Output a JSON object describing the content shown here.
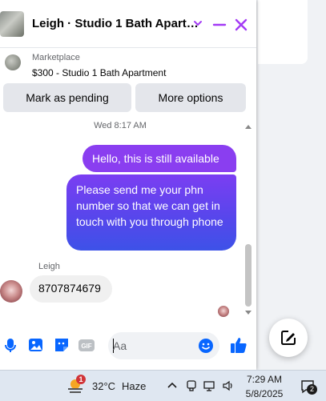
{
  "header": {
    "title": "Leigh · Studio 1 Bath Apart…",
    "accent_color": "#a33af5"
  },
  "listing": {
    "source": "Marketplace",
    "title": "$300 - Studio 1 Bath Apartment"
  },
  "actions": {
    "pending_label": "Mark as pending",
    "more_label": "More options"
  },
  "messages": {
    "timestamp": "Wed 8:17 AM",
    "outgoing": [
      "Hello, this is still available",
      "Please send me your phn number so that we can get in touch with you through phone"
    ],
    "sender_name": "Leigh",
    "incoming": "8707874679"
  },
  "composer": {
    "placeholder": "Aa",
    "icons": [
      "microphone-icon",
      "photo-icon",
      "sticker-icon",
      "gif-icon",
      "emoji-icon",
      "thumbs-up-icon"
    ]
  },
  "taskbar": {
    "weather_badge": "1",
    "temperature": "32°C",
    "condition": "Haze",
    "time": "7:29 AM",
    "date": "5/8/2025",
    "notification_count": "2"
  }
}
